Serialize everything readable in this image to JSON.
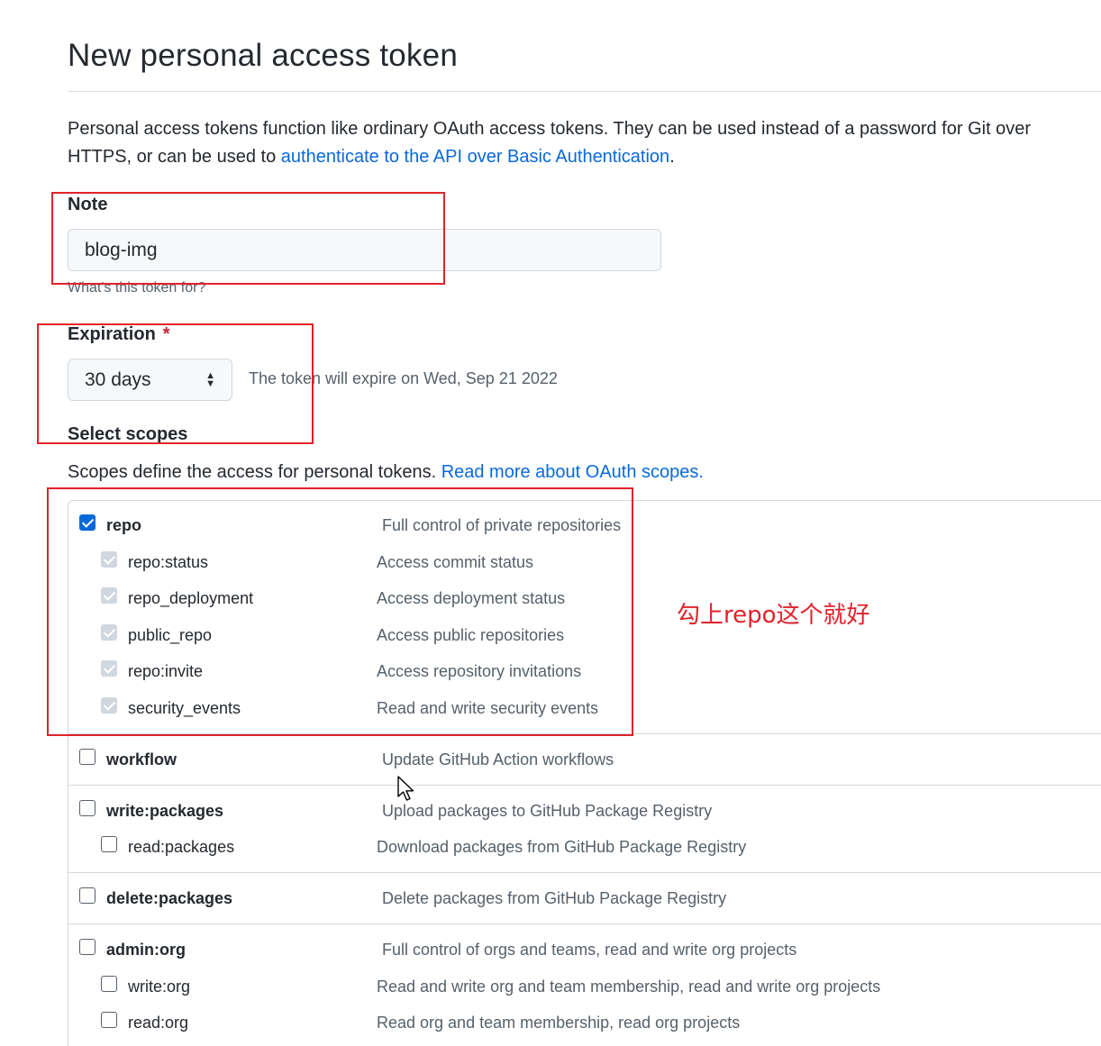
{
  "page": {
    "title": "New personal access token",
    "intro_text": "Personal access tokens function like ordinary OAuth access tokens. They can be used instead of a password for Git over HTTPS, or can be used to ",
    "intro_link": "authenticate to the API over Basic Authentication",
    "intro_end": "."
  },
  "note": {
    "label": "Note",
    "value": "blog-img",
    "hint": "What's this token for?"
  },
  "expiration": {
    "label": "Expiration",
    "required_mark": "*",
    "selected": "30 days",
    "expire_text": "The token will expire on Wed, Sep 21 2022"
  },
  "scopes": {
    "heading": "Select scopes",
    "description": "Scopes define the access for personal tokens. ",
    "link": "Read more about OAuth scopes.",
    "items": [
      {
        "name": "repo",
        "desc": "Full control of private repositories",
        "checked": true
      },
      {
        "name": "repo:status",
        "desc": "Access commit status",
        "checked": true
      },
      {
        "name": "repo_deployment",
        "desc": "Access deployment status",
        "checked": true
      },
      {
        "name": "public_repo",
        "desc": "Access public repositories",
        "checked": true
      },
      {
        "name": "repo:invite",
        "desc": "Access repository invitations",
        "checked": true
      },
      {
        "name": "security_events",
        "desc": "Read and write security events",
        "checked": true
      },
      {
        "name": "workflow",
        "desc": "Update GitHub Action workflows",
        "checked": false
      },
      {
        "name": "write:packages",
        "desc": "Upload packages to GitHub Package Registry",
        "checked": false
      },
      {
        "name": "read:packages",
        "desc": "Download packages from GitHub Package Registry",
        "checked": false
      },
      {
        "name": "delete:packages",
        "desc": "Delete packages from GitHub Package Registry",
        "checked": false
      },
      {
        "name": "admin:org",
        "desc": "Full control of orgs and teams, read and write org projects",
        "checked": false
      },
      {
        "name": "write:org",
        "desc": "Read and write org and team membership, read and write org projects",
        "checked": false
      },
      {
        "name": "read:org",
        "desc": "Read org and team membership, read org projects",
        "checked": false
      }
    ]
  },
  "annotation": {
    "text": "勾上repo这个就好",
    "color": "#e0222b"
  },
  "colors": {
    "accent": "#0969da",
    "annotation_red": "#e0222b"
  }
}
